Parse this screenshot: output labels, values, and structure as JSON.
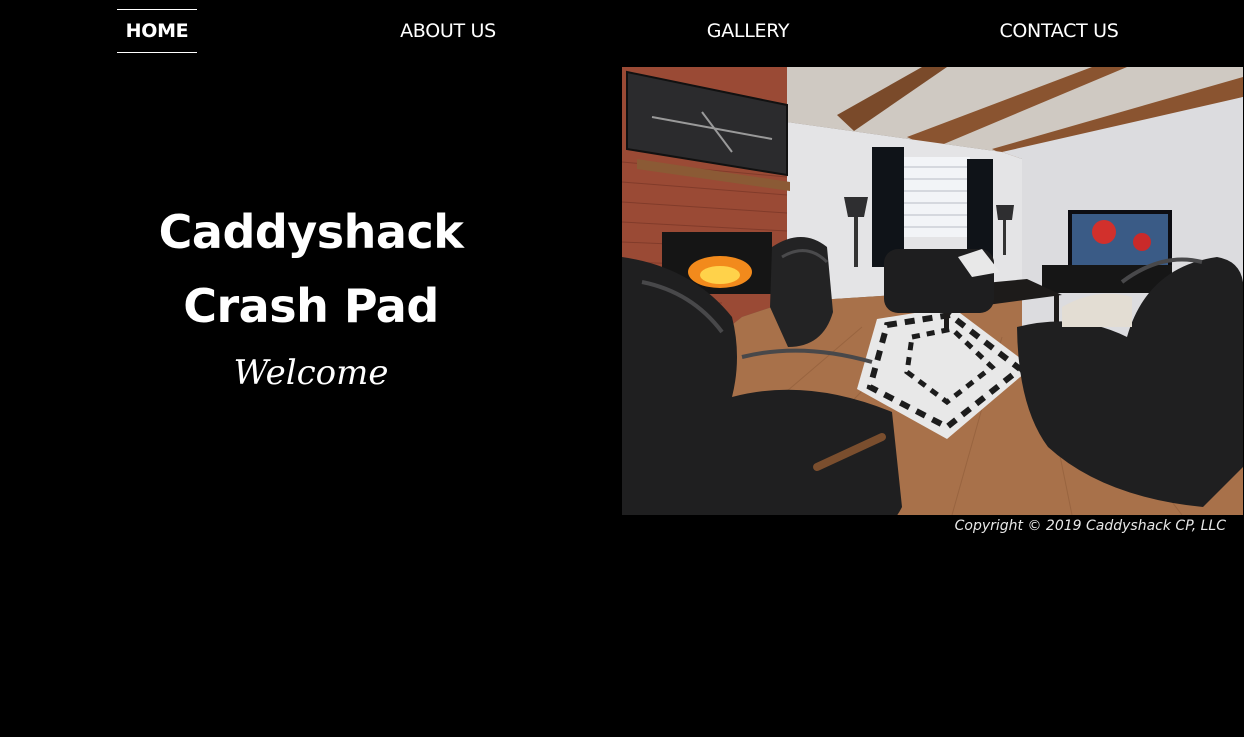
{
  "nav": {
    "home": "HOME",
    "about": "ABOUT US",
    "gallery": "GALLERY",
    "contact": "CONTACT US"
  },
  "hero": {
    "title_line1": "Caddyshack",
    "title_line2": "Crash Pad",
    "subtitle": "Welcome"
  },
  "footer": {
    "copyright": "Copyright © 2019 Caddyshack CP, LLC"
  },
  "colors": {
    "background": "#000000",
    "text": "#ffffff"
  }
}
